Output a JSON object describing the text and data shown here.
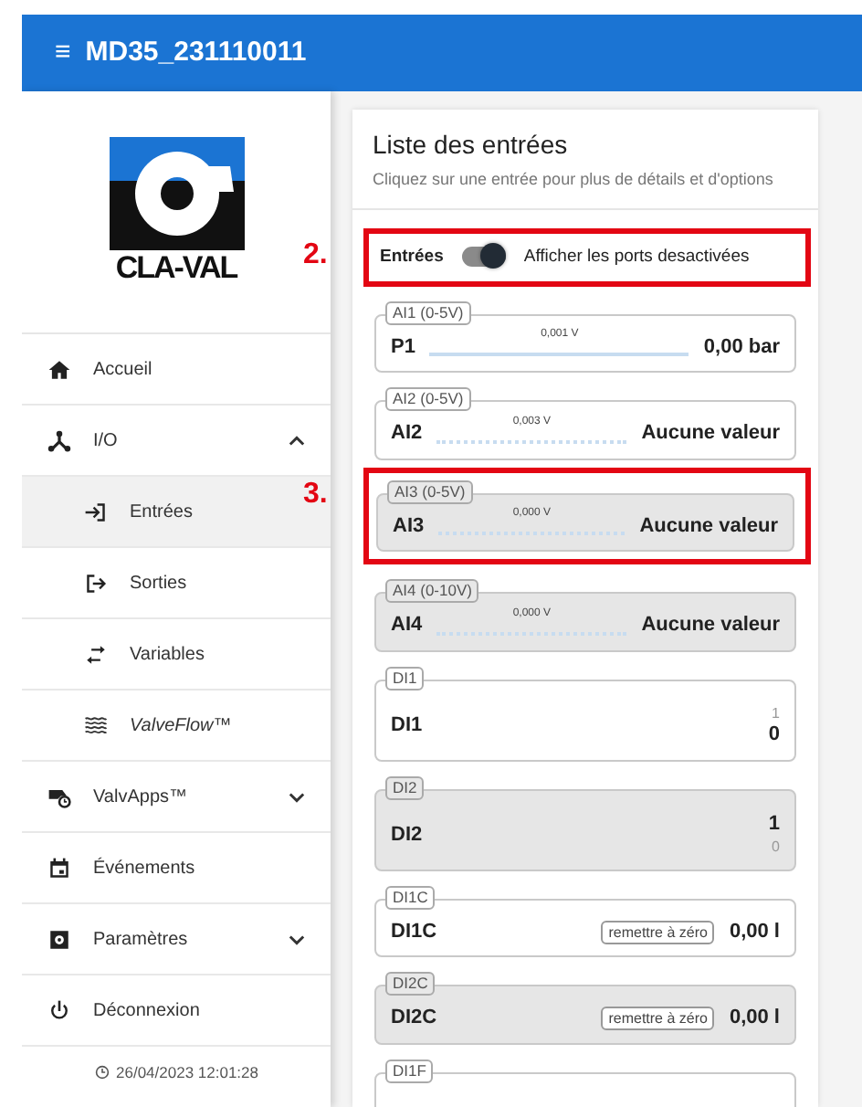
{
  "header": {
    "menu_icon": "≡",
    "title": "MD35_231110011"
  },
  "sidebar": {
    "logo_text": "CLA-VAL",
    "items": [
      {
        "label": "Accueil",
        "selected": false
      },
      {
        "label": "I/O",
        "selected": false,
        "expanded": true,
        "children": [
          {
            "label": "Entrées",
            "selected": true,
            "italic": false
          },
          {
            "label": "Sorties",
            "selected": false,
            "italic": false
          },
          {
            "label": "Variables",
            "selected": false,
            "italic": false
          },
          {
            "label": "ValveFlow™",
            "selected": false,
            "italic": true
          }
        ]
      },
      {
        "label": "ValvApps™",
        "selected": false,
        "expanded": false
      },
      {
        "label": "Événements",
        "selected": false
      },
      {
        "label": "Paramètres",
        "selected": false,
        "expanded": false
      },
      {
        "label": "Déconnexion",
        "selected": false
      }
    ],
    "timestamp": "26/04/2023 12:01:28"
  },
  "main": {
    "title": "Liste des entrées",
    "subtitle": "Cliquez sur une entrée pour plus de détails et d'options",
    "toggle_row": {
      "label": "Entrées",
      "switch_label": "Afficher les ports desactivées",
      "on": true,
      "annotation": "2."
    },
    "inputs": [
      {
        "kind": "analog",
        "tag": "AI1 (0-5V)",
        "name": "P1",
        "reading": "0,001 V",
        "value": "0,00 bar",
        "active": true,
        "disabled": false
      },
      {
        "kind": "analog",
        "tag": "AI2 (0-5V)",
        "name": "AI2",
        "reading": "0,003 V",
        "value": "Aucune valeur",
        "active": false,
        "disabled": false
      },
      {
        "kind": "analog",
        "tag": "AI3 (0-5V)",
        "name": "AI3",
        "reading": "0,000 V",
        "value": "Aucune valeur",
        "active": false,
        "disabled": true,
        "annotation": "3."
      },
      {
        "kind": "analog",
        "tag": "AI4 (0-10V)",
        "name": "AI4",
        "reading": "0,000 V",
        "value": "Aucune valeur",
        "active": false,
        "disabled": true
      },
      {
        "kind": "digital",
        "tag": "DI1",
        "name": "DI1",
        "states": [
          {
            "text": "1",
            "selected": false
          },
          {
            "text": "0",
            "selected": true
          }
        ],
        "disabled": false
      },
      {
        "kind": "digital",
        "tag": "DI2",
        "name": "DI2",
        "states": [
          {
            "text": "1",
            "selected": true
          },
          {
            "text": "0",
            "selected": false
          }
        ],
        "disabled": true
      },
      {
        "kind": "counter",
        "tag": "DI1C",
        "name": "DI1C",
        "button": "remettre à zéro",
        "value": "0,00 l",
        "disabled": false
      },
      {
        "kind": "counter",
        "tag": "DI2C",
        "name": "DI2C",
        "button": "remettre à zéro",
        "value": "0,00 l",
        "disabled": true
      },
      {
        "kind": "partial",
        "tag": "DI1F",
        "disabled": false
      }
    ]
  }
}
